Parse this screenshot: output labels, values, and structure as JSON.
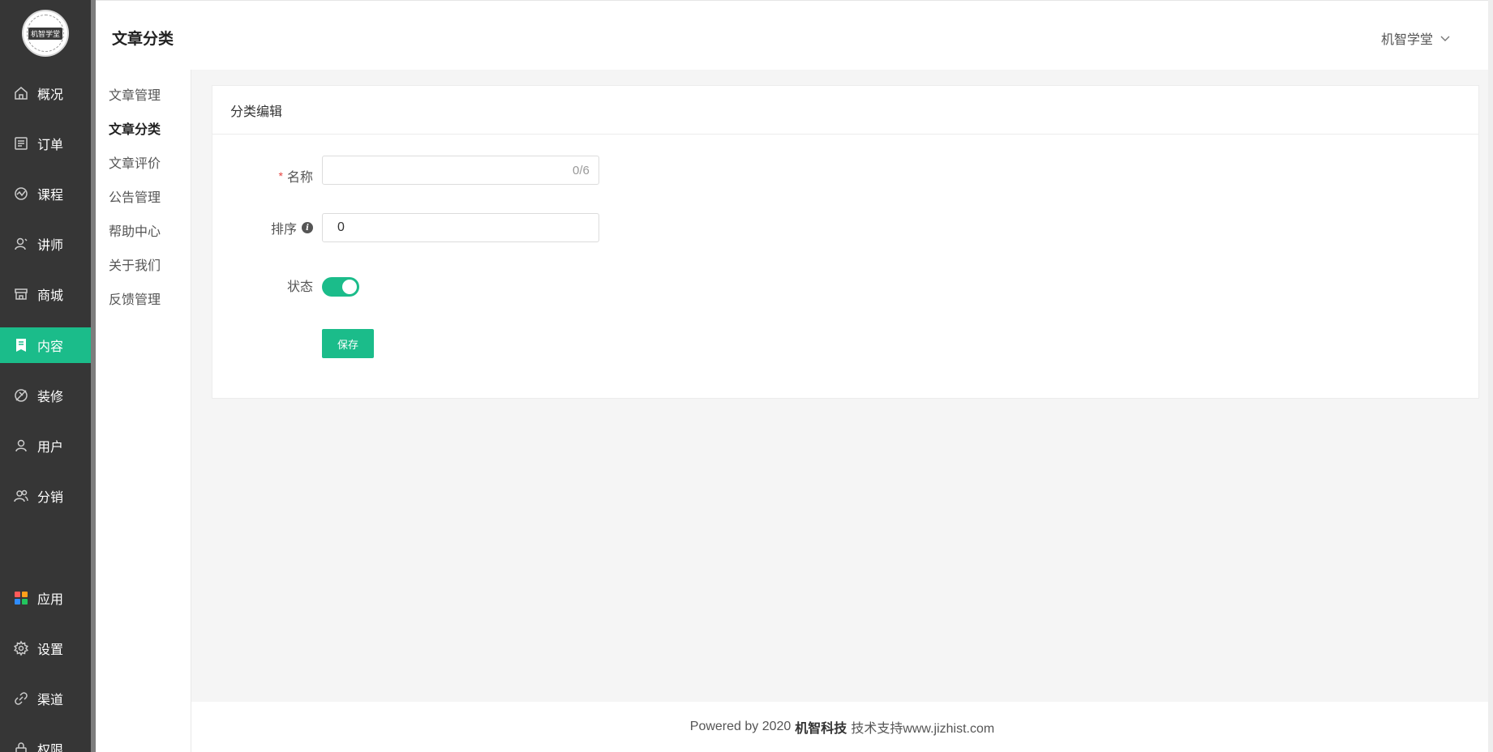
{
  "sidebar": {
    "logo_text": "机智学堂",
    "items": [
      {
        "label": "概况",
        "icon": "home-icon"
      },
      {
        "label": "订单",
        "icon": "order-icon"
      },
      {
        "label": "课程",
        "icon": "course-icon"
      },
      {
        "label": "讲师",
        "icon": "teacher-icon"
      },
      {
        "label": "商城",
        "icon": "store-icon"
      },
      {
        "label": "内容",
        "icon": "content-icon",
        "active": true
      },
      {
        "label": "装修",
        "icon": "decorate-icon"
      },
      {
        "label": "用户",
        "icon": "user-icon"
      },
      {
        "label": "分销",
        "icon": "distribution-icon"
      },
      {
        "label": "应用",
        "icon": "apps-icon"
      },
      {
        "label": "设置",
        "icon": "gear-icon"
      },
      {
        "label": "渠道",
        "icon": "link-icon"
      },
      {
        "label": "权限",
        "icon": "permission-icon"
      }
    ],
    "active_color": "#1bbc8a"
  },
  "header": {
    "title": "文章分类",
    "user": "机智学堂"
  },
  "subnav": {
    "items": [
      {
        "label": "文章管理"
      },
      {
        "label": "文章分类",
        "active": true
      },
      {
        "label": "文章评价"
      },
      {
        "label": "公告管理"
      },
      {
        "label": "帮助中心"
      },
      {
        "label": "关于我们"
      },
      {
        "label": "反馈管理"
      }
    ]
  },
  "form": {
    "card_title": "分类编辑",
    "name_label": "名称",
    "name_required": "*",
    "name_value": "",
    "name_counter": "0/6",
    "sort_label": "排序",
    "sort_info": "i",
    "sort_value": "0",
    "status_label": "状态",
    "status_on": true,
    "save_label": "保存"
  },
  "footer": {
    "prefix": "Powered by 2020",
    "brand": "机智科技",
    "suffix": "技术支持www.jizhist.com"
  }
}
